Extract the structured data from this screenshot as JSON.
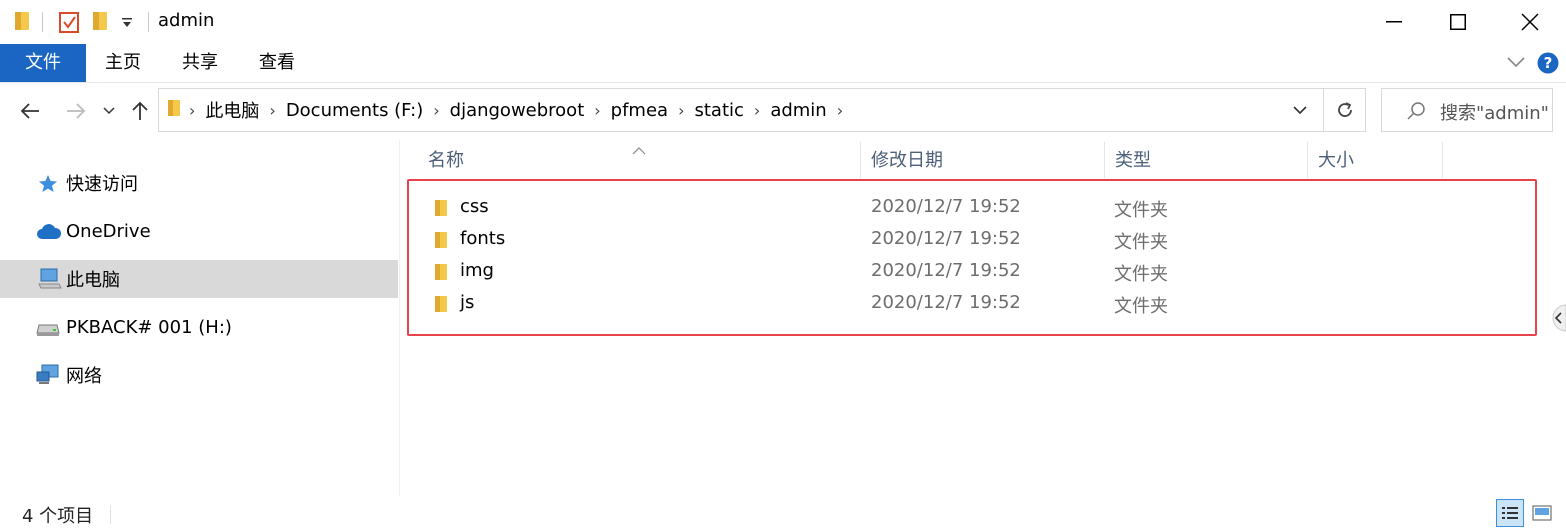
{
  "window": {
    "title": "admin"
  },
  "ribbon": {
    "tabs": [
      "文件",
      "主页",
      "共享",
      "查看"
    ]
  },
  "address": {
    "crumbs": [
      "此电脑",
      "Documents (F:)",
      "djangowebroot",
      "pfmea",
      "static",
      "admin"
    ]
  },
  "search": {
    "placeholder": "搜索\"admin\""
  },
  "nav": {
    "items": [
      "快速访问",
      "OneDrive",
      "此电脑",
      "PKBACK# 001 (H:)",
      "网络"
    ]
  },
  "columns": {
    "name": "名称",
    "modified": "修改日期",
    "type": "类型",
    "size": "大小"
  },
  "files": [
    {
      "name": "css",
      "modified": "2020/12/7 19:52",
      "type": "文件夹"
    },
    {
      "name": "fonts",
      "modified": "2020/12/7 19:52",
      "type": "文件夹"
    },
    {
      "name": "img",
      "modified": "2020/12/7 19:52",
      "type": "文件夹"
    },
    {
      "name": "js",
      "modified": "2020/12/7 19:52",
      "type": "文件夹"
    }
  ],
  "status": {
    "count": "4 个项目"
  },
  "colors": {
    "accent": "#1a66c2",
    "highlight": "#e8434c",
    "folder": "#f4c84a",
    "selected": "#d9d9d9"
  },
  "icons": {
    "folder": "folder-icon",
    "properties": "properties-icon",
    "help": "help-icon",
    "search": "search-icon"
  }
}
